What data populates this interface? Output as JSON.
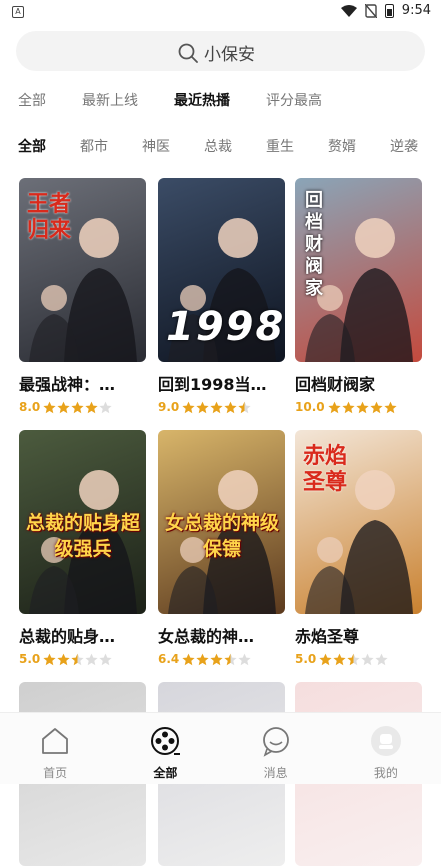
{
  "status_bar": {
    "left_icon": "A",
    "time": "9:54",
    "battery": "battery-icon",
    "wifi": "wifi-icon",
    "signal": "no-sim-icon"
  },
  "search": {
    "placeholder": "小保安",
    "icon": "search-icon"
  },
  "sort_tabs": [
    {
      "label": "全部",
      "active": false
    },
    {
      "label": "最新上线",
      "active": false
    },
    {
      "label": "最近热播",
      "active": true
    },
    {
      "label": "评分最高",
      "active": false
    }
  ],
  "genre_tabs": [
    {
      "label": "全部",
      "active": true
    },
    {
      "label": "都市",
      "active": false
    },
    {
      "label": "神医",
      "active": false
    },
    {
      "label": "总裁",
      "active": false
    },
    {
      "label": "重生",
      "active": false
    },
    {
      "label": "赘婿",
      "active": false
    },
    {
      "label": "逆袭",
      "active": false
    }
  ],
  "colors": {
    "accent": "#e8a21b",
    "star_off": "#dddddd"
  },
  "dramas": [
    {
      "title": "最强战神：…",
      "score": "8.0",
      "stars": 4.0,
      "poster_text": "王者归来",
      "poster_colors": [
        "#6c6f78",
        "#2a2c33"
      ]
    },
    {
      "title": "回到1998当…",
      "score": "9.0",
      "stars": 4.5,
      "poster_text": "1998",
      "poster_colors": [
        "#3b4c66",
        "#0e1420"
      ]
    },
    {
      "title": "回档财阀家",
      "score": "10.0",
      "stars": 5.0,
      "poster_text": "回档财阀家",
      "poster_colors": [
        "#8aa5b8",
        "#c44a3d"
      ]
    },
    {
      "title": "总裁的贴身…",
      "score": "5.0",
      "stars": 2.5,
      "poster_text": "总裁的贴身超级强兵",
      "poster_colors": [
        "#4c5b3e",
        "#1c2118"
      ]
    },
    {
      "title": "女总裁的神…",
      "score": "6.4",
      "stars": 3.5,
      "poster_text": "女总裁的神级保镖",
      "poster_colors": [
        "#d8b56a",
        "#5c3a1e"
      ]
    },
    {
      "title": "赤焰圣尊",
      "score": "5.0",
      "stars": 2.5,
      "poster_text": "赤焰圣尊",
      "poster_colors": [
        "#f3e6d8",
        "#c9812f"
      ]
    },
    {
      "title": "",
      "score": "",
      "stars": 0,
      "poster_text": "",
      "poster_colors": [
        "#cfcfcf",
        "#e8e8e8"
      ]
    },
    {
      "title": "",
      "score": "",
      "stars": 0,
      "poster_text": "",
      "poster_colors": [
        "#d6d6dc",
        "#eeeeee"
      ]
    },
    {
      "title": "",
      "score": "",
      "stars": 0,
      "poster_text": "",
      "poster_colors": [
        "#f5dede",
        "#f9efef"
      ]
    }
  ],
  "bottom_nav": [
    {
      "label": "首页",
      "icon": "home-icon",
      "active": false
    },
    {
      "label": "全部",
      "icon": "film-reel-icon",
      "active": true
    },
    {
      "label": "消息",
      "icon": "chat-bubble-icon",
      "active": false
    },
    {
      "label": "我的",
      "icon": "avatar-icon",
      "active": false
    }
  ]
}
